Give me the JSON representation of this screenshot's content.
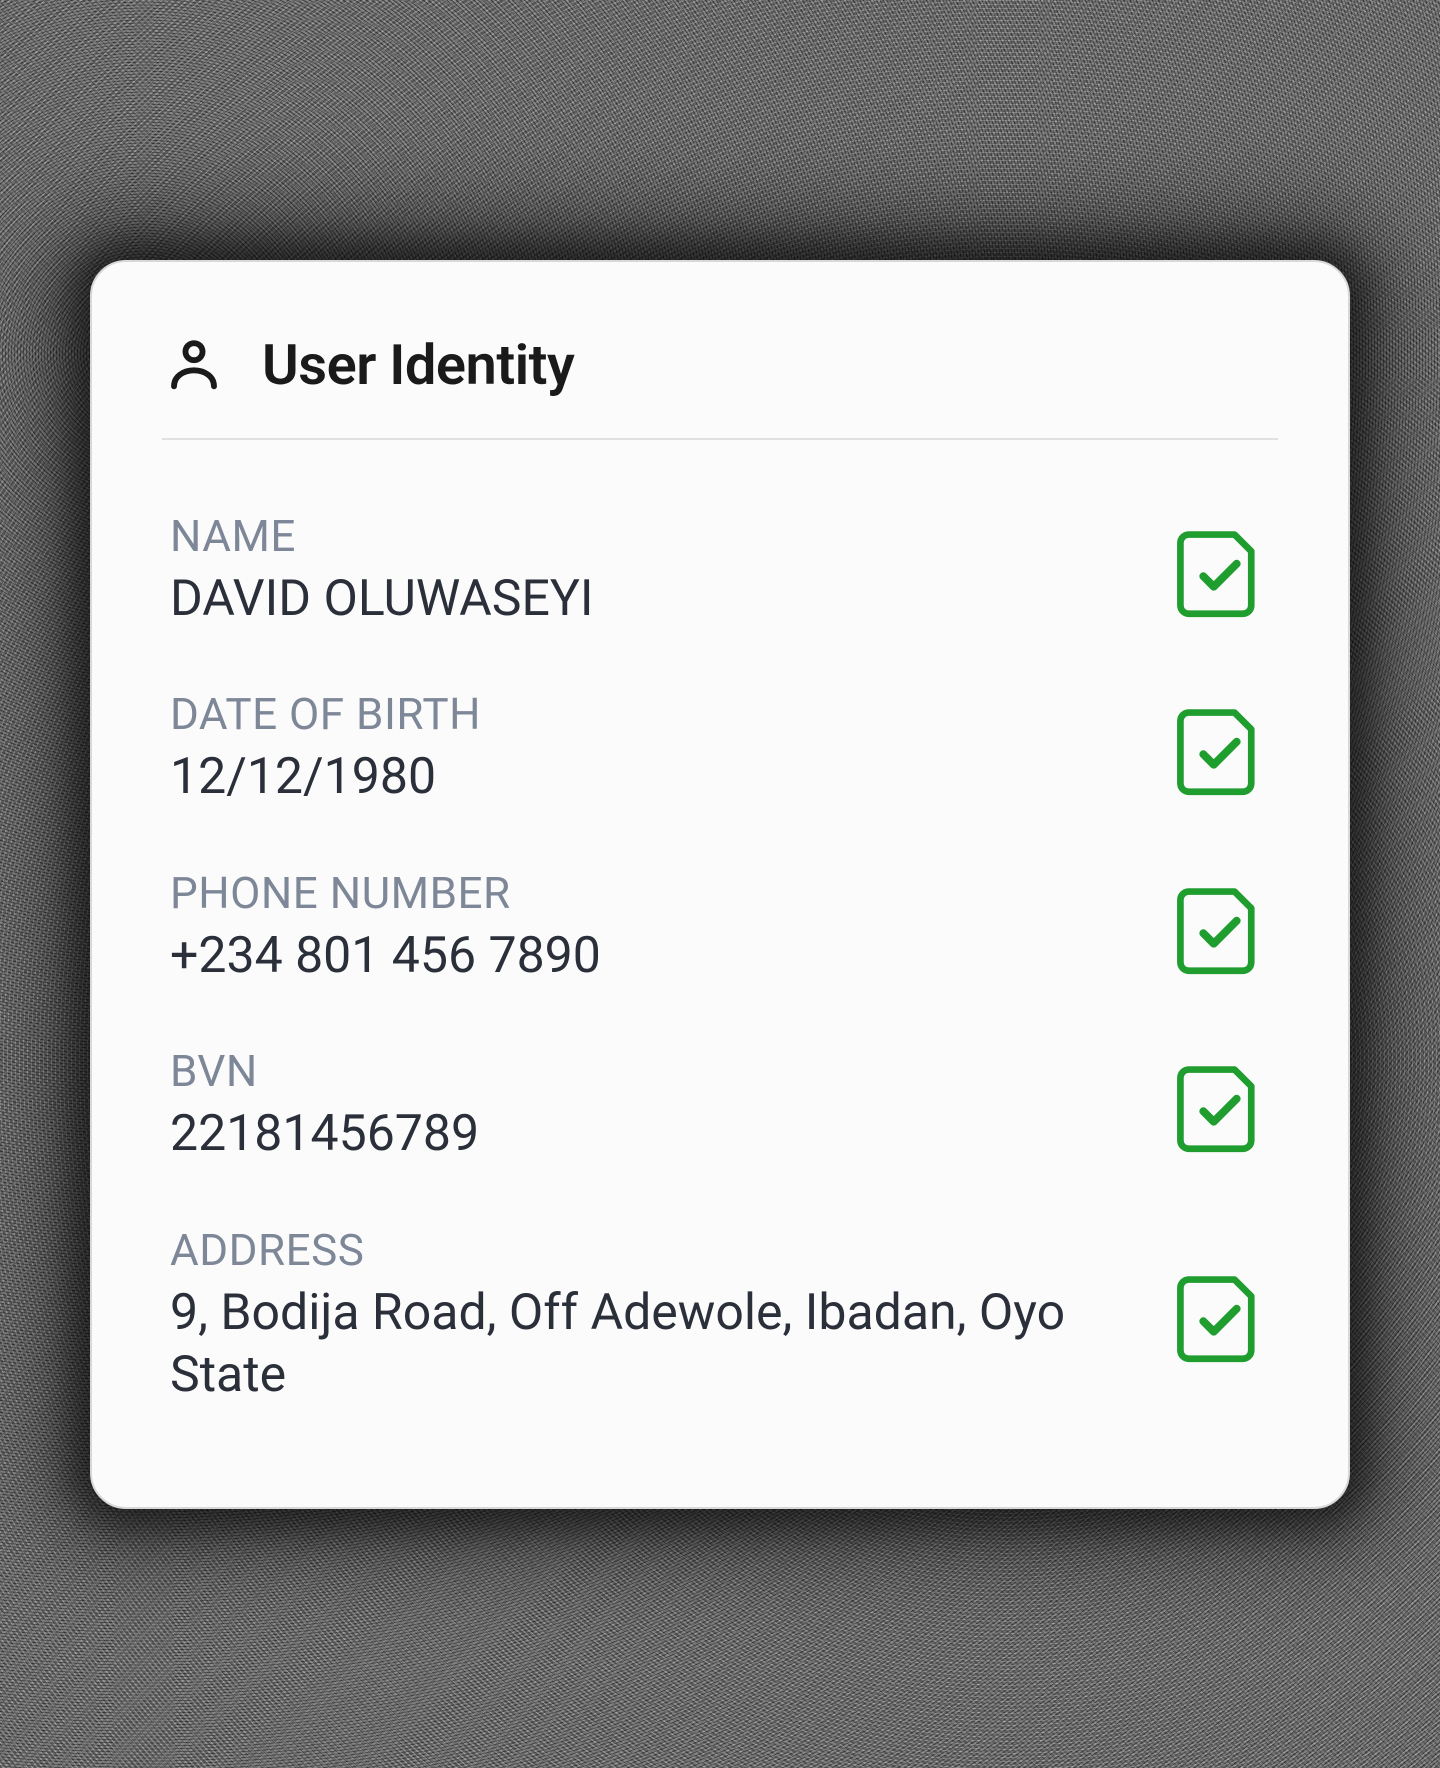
{
  "card": {
    "title": "User Identity"
  },
  "fields": [
    {
      "label": "NAME",
      "value": "DAVID OLUWASEYI",
      "verified": true
    },
    {
      "label": "DATE OF BIRTH",
      "value": "12/12/1980",
      "verified": true
    },
    {
      "label": "PHONE NUMBER",
      "value": "+234 801 456 7890",
      "verified": true
    },
    {
      "label": "BVN",
      "value": "22181456789",
      "verified": true
    },
    {
      "label": "ADDRESS",
      "value": "9, Bodija Road, Off Adewole, Ibadan, Oyo State",
      "verified": true
    }
  ],
  "colors": {
    "verified_green": "#1f9d2f"
  }
}
